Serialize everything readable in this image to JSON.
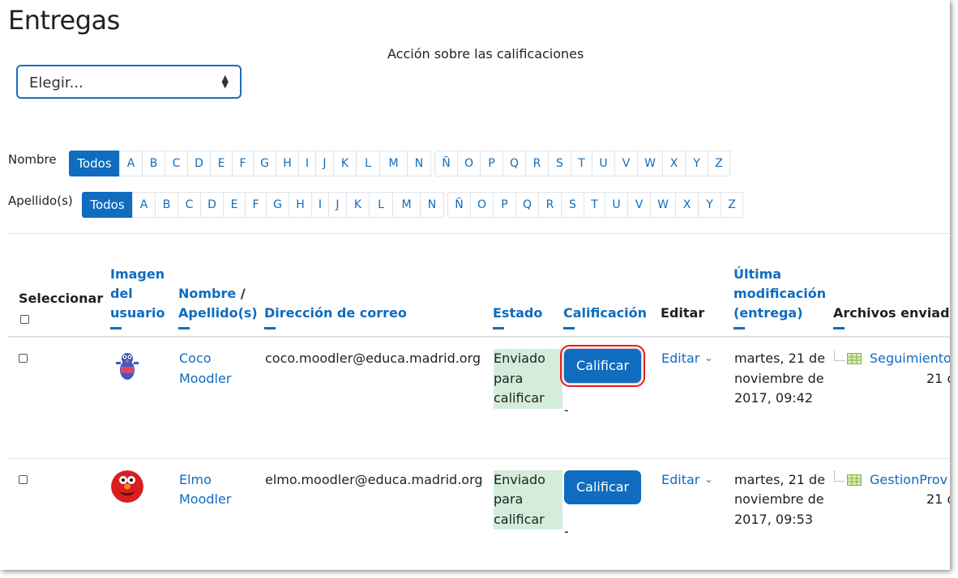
{
  "page": {
    "title": "Entregas"
  },
  "grading_action": {
    "label": "Acción sobre las calificaciones",
    "selected": "Elegir..."
  },
  "filters": {
    "first_name": {
      "label": "Nombre",
      "all": "Todos",
      "letters_a": [
        "A",
        "B",
        "C",
        "D",
        "E",
        "F",
        "G",
        "H",
        "I",
        "J",
        "K",
        "L",
        "M",
        "N"
      ],
      "letters_b": [
        "Ñ",
        "O",
        "P",
        "Q",
        "R",
        "S",
        "T",
        "U",
        "V",
        "W",
        "X",
        "Y",
        "Z"
      ]
    },
    "last_name": {
      "label": "Apellido(s)",
      "all": "Todos",
      "letters_a": [
        "A",
        "B",
        "C",
        "D",
        "E",
        "F",
        "G",
        "H",
        "I",
        "J",
        "K",
        "L",
        "M",
        "N"
      ],
      "letters_b": [
        "Ñ",
        "O",
        "P",
        "Q",
        "R",
        "S",
        "T",
        "U",
        "V",
        "W",
        "X",
        "Y",
        "Z"
      ]
    }
  },
  "table": {
    "headers": {
      "select": "Seleccionar",
      "picture": "Imagen del usuario",
      "name_first": "Nombre",
      "name_sep": " / ",
      "name_last": "Apellido(s)",
      "email": "Dirección de correo",
      "status": "Estado",
      "grade": "Calificación",
      "edit": "Editar",
      "modified": "Última modificación (entrega)",
      "files": "Archivos enviados"
    },
    "rows": [
      {
        "name": "Coco Moodler",
        "email": "coco.moodler@educa.madrid.org",
        "status": "Enviado para calificar",
        "grade_button": "Calificar",
        "grade_value": "-",
        "edit": "Editar",
        "modified": "martes, 21 de noviembre de 2017, 09:42",
        "file_name": "Seguimiento",
        "file_date": "21 d",
        "avatar_icon": "grover-avatar-icon"
      },
      {
        "name": "Elmo Moodler",
        "email": "elmo.moodler@educa.madrid.org",
        "status": "Enviado para calificar",
        "grade_button": "Calificar",
        "grade_value": "-",
        "edit": "Editar",
        "modified": "martes, 21 de noviembre de 2017, 09:53",
        "file_name": "GestionProv",
        "file_date": "21 d",
        "avatar_icon": "elmo-avatar-icon"
      }
    ]
  },
  "colors": {
    "primary": "#0f6cbf",
    "status_bg": "#d4edda",
    "highlight": "#e02020"
  }
}
